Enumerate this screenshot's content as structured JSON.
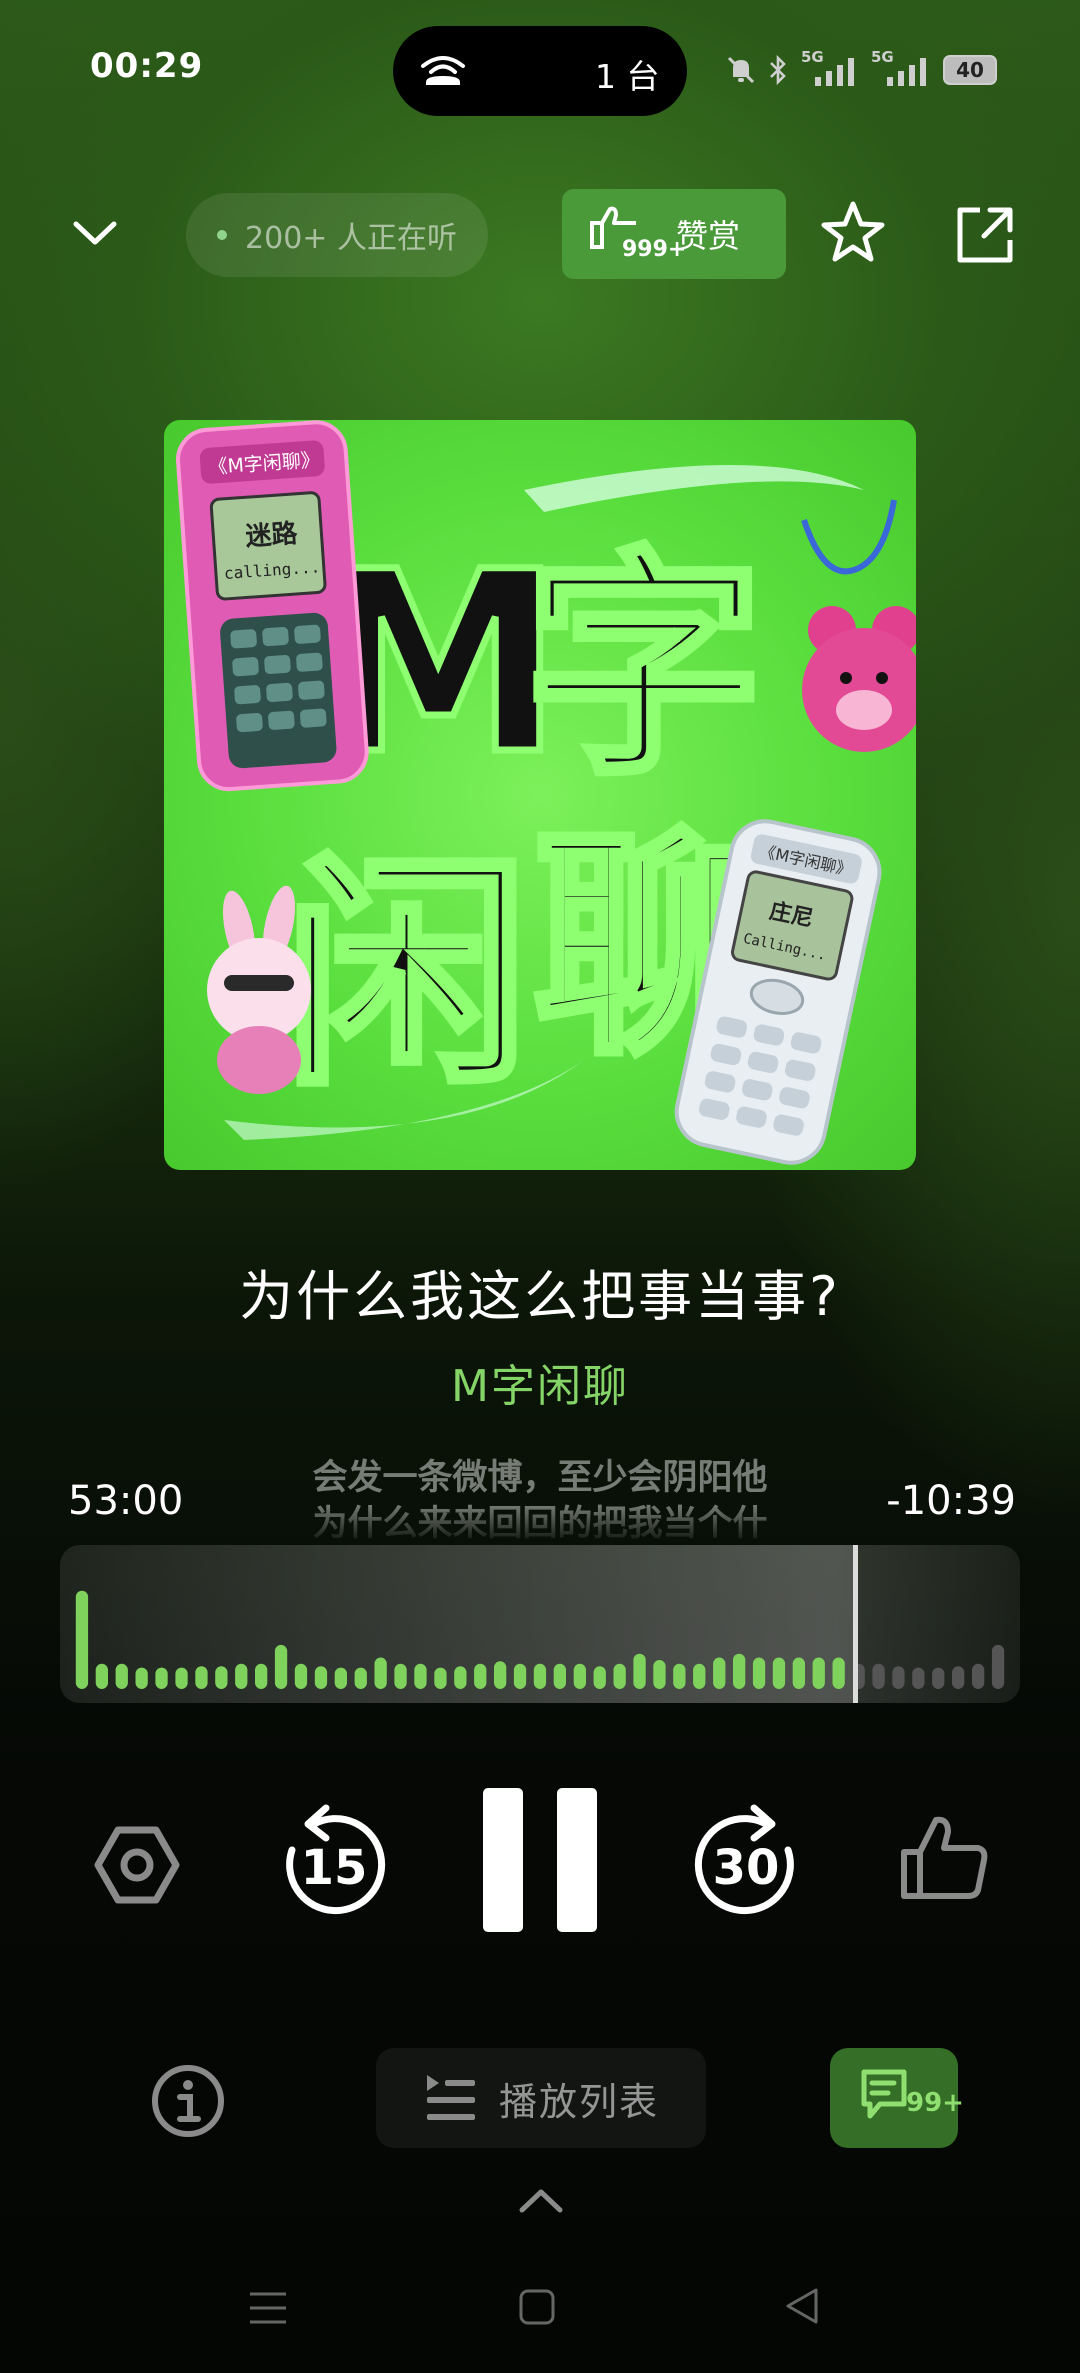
{
  "status_bar": {
    "time": "00:29",
    "island_count": "1 台",
    "network_1": "5G",
    "network_2": "5G",
    "battery": "40"
  },
  "top_bar": {
    "listeners": "200+ 人正在听",
    "reward_count": "999+",
    "reward_label": "赞赏"
  },
  "cover": {
    "title_chars": [
      "M",
      "字",
      "闲",
      "聊"
    ],
    "phone_badge": "《M字闲聊》",
    "phone_1_text": "迷路",
    "phone_1_calling": "calling...",
    "phone_2_text": "庄尼",
    "phone_2_calling": "Calling..."
  },
  "episode": {
    "title": "为什么我这么把事当事?",
    "show": "M字闲聊"
  },
  "progress": {
    "elapsed": "53:00",
    "remaining": "-10:39",
    "played_fraction": 0.826,
    "subtitle_line_1": "会发一条微博，至少会阴阳他",
    "subtitle_line_2": "为什么来来回回的把我当个什"
  },
  "controls": {
    "rewind_seconds": "15",
    "forward_seconds": "30"
  },
  "bottom": {
    "playlist_label": "播放列表",
    "comments_count": "99+"
  },
  "waveform": [
    0.78,
    0.2,
    0.2,
    0.17,
    0.17,
    0.17,
    0.18,
    0.18,
    0.2,
    0.2,
    0.35,
    0.2,
    0.18,
    0.17,
    0.17,
    0.25,
    0.2,
    0.2,
    0.17,
    0.18,
    0.2,
    0.22,
    0.2,
    0.2,
    0.2,
    0.2,
    0.18,
    0.2,
    0.28,
    0.23,
    0.2,
    0.2,
    0.25,
    0.28,
    0.25,
    0.25,
    0.25,
    0.25,
    0.25,
    0.2,
    0.2,
    0.18,
    0.17,
    0.17,
    0.18,
    0.2,
    0.35
  ],
  "colors": {
    "accent": "#7fd25c",
    "accent_dim": "#4a9a3a",
    "bar_unplayed": "#555555"
  }
}
